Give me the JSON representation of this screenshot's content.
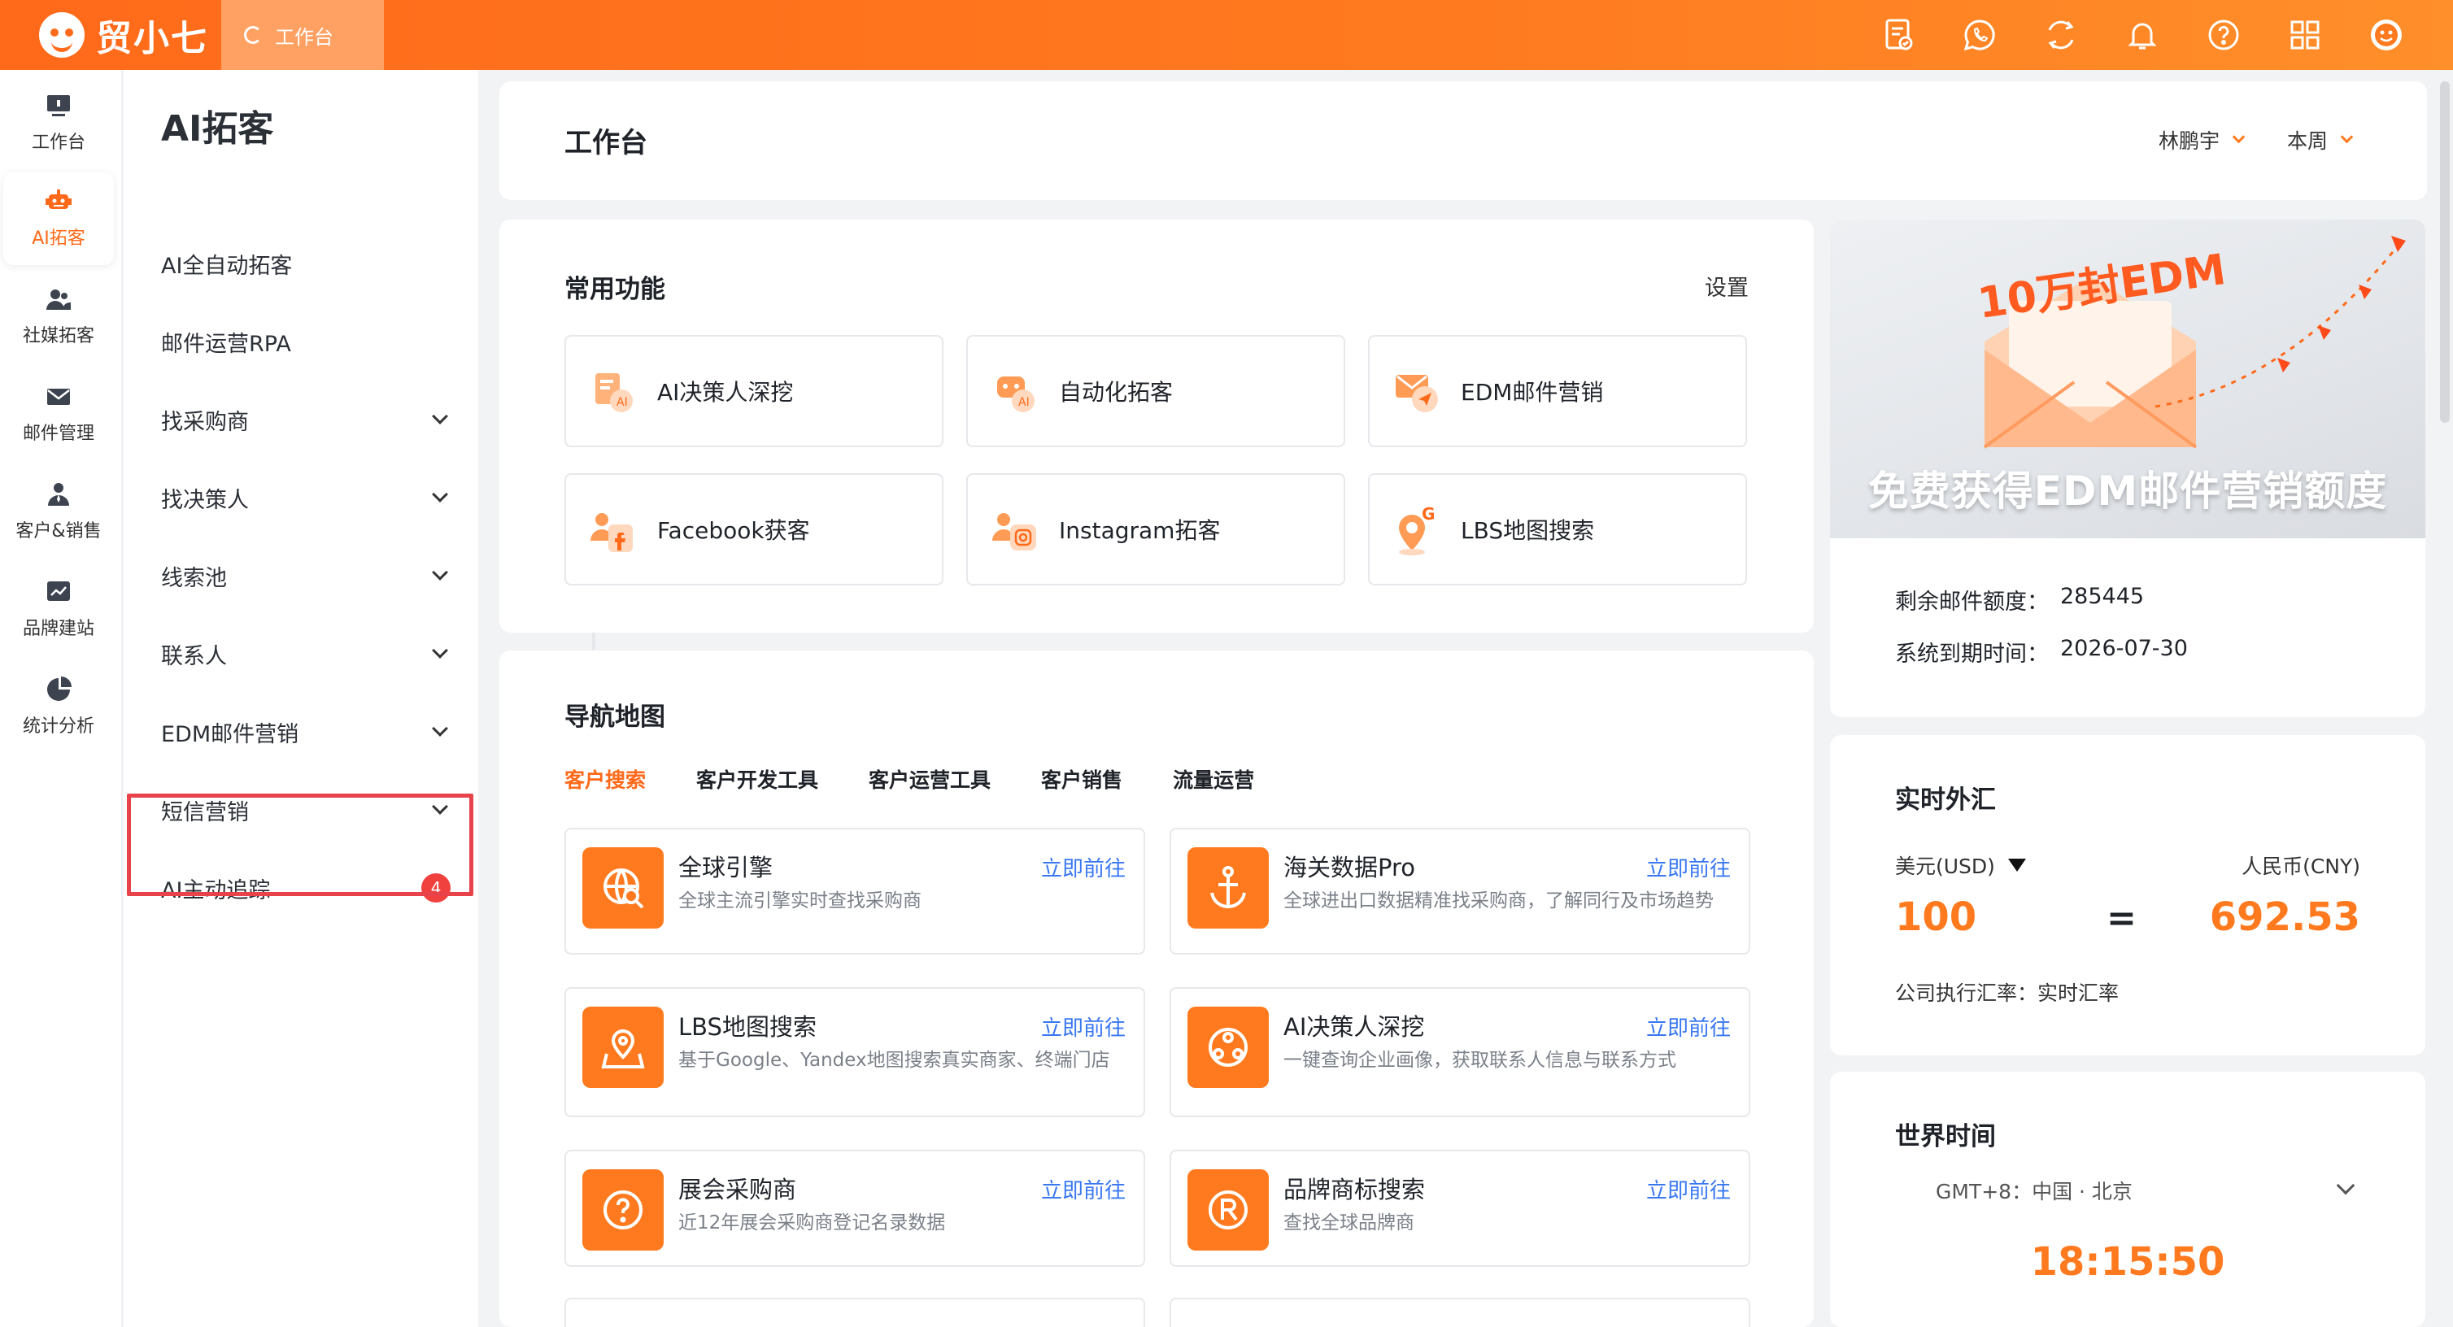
{
  "brand": {
    "name": "贸小七",
    "accent": "#ff6a1a"
  },
  "top_tab": {
    "label": "工作台"
  },
  "top_icons": [
    "checklist-icon",
    "whatsapp-icon",
    "share-refresh-icon",
    "bell-icon",
    "help-icon",
    "apps-grid-icon",
    "avatar-icon"
  ],
  "rail": [
    {
      "label": "工作台",
      "icon": "monitor-icon"
    },
    {
      "label": "AI拓客",
      "icon": "robot-icon",
      "active": true
    },
    {
      "label": "社媒拓客",
      "icon": "users-icon"
    },
    {
      "label": "邮件管理",
      "icon": "mail-icon"
    },
    {
      "label": "客户&销售",
      "icon": "person-tie-icon"
    },
    {
      "label": "品牌建站",
      "icon": "chart-icon"
    },
    {
      "label": "统计分析",
      "icon": "pie-icon"
    }
  ],
  "subnav": {
    "title": "AI拓客",
    "items": [
      {
        "label": "AI全自动拓客"
      },
      {
        "label": "邮件运营RPA"
      },
      {
        "label": "找采购商"
      },
      {
        "label": "找决策人"
      },
      {
        "label": "线索池"
      },
      {
        "label": "联系人"
      },
      {
        "label": "EDM邮件营销"
      },
      {
        "label": "短信营销"
      },
      {
        "label": "AI主动追踪",
        "badge": "4"
      }
    ]
  },
  "header": {
    "title": "工作台",
    "user": "林鹏宇",
    "period": "本周"
  },
  "functions": {
    "title": "常用功能",
    "settings": "设置",
    "items": [
      "AI决策人深挖",
      "自动化拓客",
      "EDM邮件营销",
      "Facebook获客",
      "Instagram拓客",
      "LBS地图搜索"
    ]
  },
  "navmap": {
    "title": "导航地图",
    "tabs": [
      "客户搜索",
      "客户开发工具",
      "客户运营工具",
      "客户销售",
      "流量运营"
    ],
    "go_label": "立即前往",
    "tiles": [
      {
        "title": "全球引擎",
        "desc": "全球主流引擎实时查找采购商"
      },
      {
        "title": "海关数据Pro",
        "desc": "全球进出口数据精准找采购商，了解同行及市场趋势"
      },
      {
        "title": "LBS地图搜索",
        "desc": "基于Google、Yandex地图搜索真实商家、终端门店"
      },
      {
        "title": "AI决策人深挖",
        "desc": "一键查询企业画像，获取联系人信息与联系方式"
      },
      {
        "title": "展会采购商",
        "desc": "近12年展会采购商登记名录数据"
      },
      {
        "title": "品牌商标搜索",
        "desc": "查找全球品牌商"
      }
    ]
  },
  "promo": {
    "banner_badge": "10万封EDM",
    "banner_text": "免费获得EDM邮件营销额度",
    "remaining_label": "剩余邮件额度：",
    "remaining_value": "285445",
    "expire_label": "系统到期时间：",
    "expire_value": "2026-07-30"
  },
  "fx": {
    "title": "实时外汇",
    "from_label": "美元(USD)",
    "to_label": "人民币(CNY)",
    "from_value": "100",
    "eq": "=",
    "to_value": "692.53",
    "note": "公司执行汇率：实时汇率"
  },
  "world_time": {
    "title": "世界时间",
    "zone": "GMT+8：中国 · 北京",
    "time": "18:15:50"
  }
}
